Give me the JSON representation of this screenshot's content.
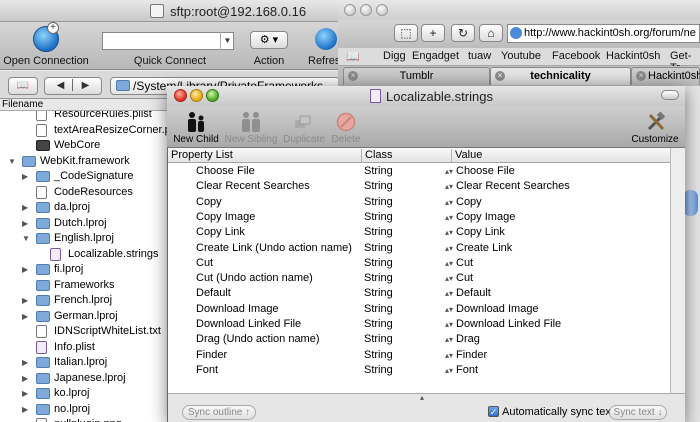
{
  "sftp": {
    "title": "sftp:root@192.168.0.16",
    "toolbar": {
      "open_connection": "Open Connection",
      "quick_connect": "Quick Connect",
      "action": "Action",
      "refresh": "Refres"
    },
    "path": "/System/Library/PrivateFrameworks",
    "column_header": "Filename",
    "files": [
      {
        "name": "ResourceRules.plist",
        "type": "doc",
        "indent": 1,
        "expandable": false
      },
      {
        "name": "textAreaResizeCorner.png",
        "type": "doc",
        "indent": 1,
        "expandable": false
      },
      {
        "name": "WebCore",
        "type": "webcore",
        "indent": 1,
        "expandable": false
      },
      {
        "name": "WebKit.framework",
        "type": "folder",
        "indent": 0,
        "expandable": true,
        "expanded": true
      },
      {
        "name": "_CodeSignature",
        "type": "folder",
        "indent": 1,
        "expandable": true
      },
      {
        "name": "CodeResources",
        "type": "doc",
        "indent": 1,
        "expandable": false
      },
      {
        "name": "da.lproj",
        "type": "folder",
        "indent": 1,
        "expandable": true
      },
      {
        "name": "Dutch.lproj",
        "type": "folder",
        "indent": 1,
        "expandable": true
      },
      {
        "name": "English.lproj",
        "type": "folder",
        "indent": 1,
        "expandable": true,
        "expanded": true
      },
      {
        "name": "Localizable.strings",
        "type": "doc-purple",
        "indent": 2,
        "expandable": false
      },
      {
        "name": "fi.lproj",
        "type": "folder",
        "indent": 1,
        "expandable": true
      },
      {
        "name": "Frameworks",
        "type": "folder",
        "indent": 1,
        "expandable": false
      },
      {
        "name": "French.lproj",
        "type": "folder",
        "indent": 1,
        "expandable": true
      },
      {
        "name": "German.lproj",
        "type": "folder",
        "indent": 1,
        "expandable": true
      },
      {
        "name": "IDNScriptWhiteList.txt",
        "type": "doc",
        "indent": 1,
        "expandable": false
      },
      {
        "name": "Info.plist",
        "type": "doc-purple",
        "indent": 1,
        "expandable": false
      },
      {
        "name": "Italian.lproj",
        "type": "folder",
        "indent": 1,
        "expandable": true
      },
      {
        "name": "Japanese.lproj",
        "type": "folder",
        "indent": 1,
        "expandable": true
      },
      {
        "name": "ko.lproj",
        "type": "folder",
        "indent": 1,
        "expandable": true
      },
      {
        "name": "no.lproj",
        "type": "folder",
        "indent": 1,
        "expandable": true
      },
      {
        "name": "nullplugin.png",
        "type": "doc",
        "indent": 1,
        "expandable": false
      }
    ]
  },
  "browser": {
    "url": "http://www.hackint0sh.org/forum/ne",
    "bookmarks": [
      "Digg",
      "Engadget",
      "tuaw",
      "Youtube",
      "Facebook",
      "Hackint0sh",
      "Get-Tr"
    ],
    "tabs": [
      {
        "label": "Tumblr",
        "active": false
      },
      {
        "label": "technicality",
        "active": true
      },
      {
        "label": "Hackint0sh",
        "active": false
      }
    ]
  },
  "plist_editor": {
    "title": "Localizable.strings",
    "toolbar": {
      "new_child": "New Child",
      "new_sibling": "New Sibling",
      "duplicate": "Duplicate",
      "delete": "Delete",
      "customize": "Customize"
    },
    "columns": {
      "property": "Property List",
      "class": "Class",
      "value": "Value"
    },
    "rows": [
      {
        "key": "Choose File",
        "class": "String",
        "value": "Choose File"
      },
      {
        "key": "Clear Recent Searches",
        "class": "String",
        "value": "Clear Recent Searches"
      },
      {
        "key": "Copy",
        "class": "String",
        "value": "Copy"
      },
      {
        "key": "Copy Image",
        "class": "String",
        "value": "Copy Image"
      },
      {
        "key": "Copy Link",
        "class": "String",
        "value": "Copy Link"
      },
      {
        "key": "Create Link (Undo action name)",
        "class": "String",
        "value": "Create Link"
      },
      {
        "key": "Cut",
        "class": "String",
        "value": "Cut"
      },
      {
        "key": "Cut (Undo action name)",
        "class": "String",
        "value": "Cut"
      },
      {
        "key": "Default",
        "class": "String",
        "value": "Default"
      },
      {
        "key": "Download Image",
        "class": "String",
        "value": "Download Image"
      },
      {
        "key": "Download Linked File",
        "class": "String",
        "value": "Download Linked File"
      },
      {
        "key": "Drag (Undo action name)",
        "class": "String",
        "value": "Drag"
      },
      {
        "key": "Finder",
        "class": "String",
        "value": "Finder"
      },
      {
        "key": "Font",
        "class": "String",
        "value": "Font"
      }
    ],
    "bottom": {
      "sync_outline": "Sync outline ↑",
      "auto_sync_label": "Automatically sync text",
      "auto_sync_checked": true,
      "sync_text": "Sync text ↓"
    }
  }
}
